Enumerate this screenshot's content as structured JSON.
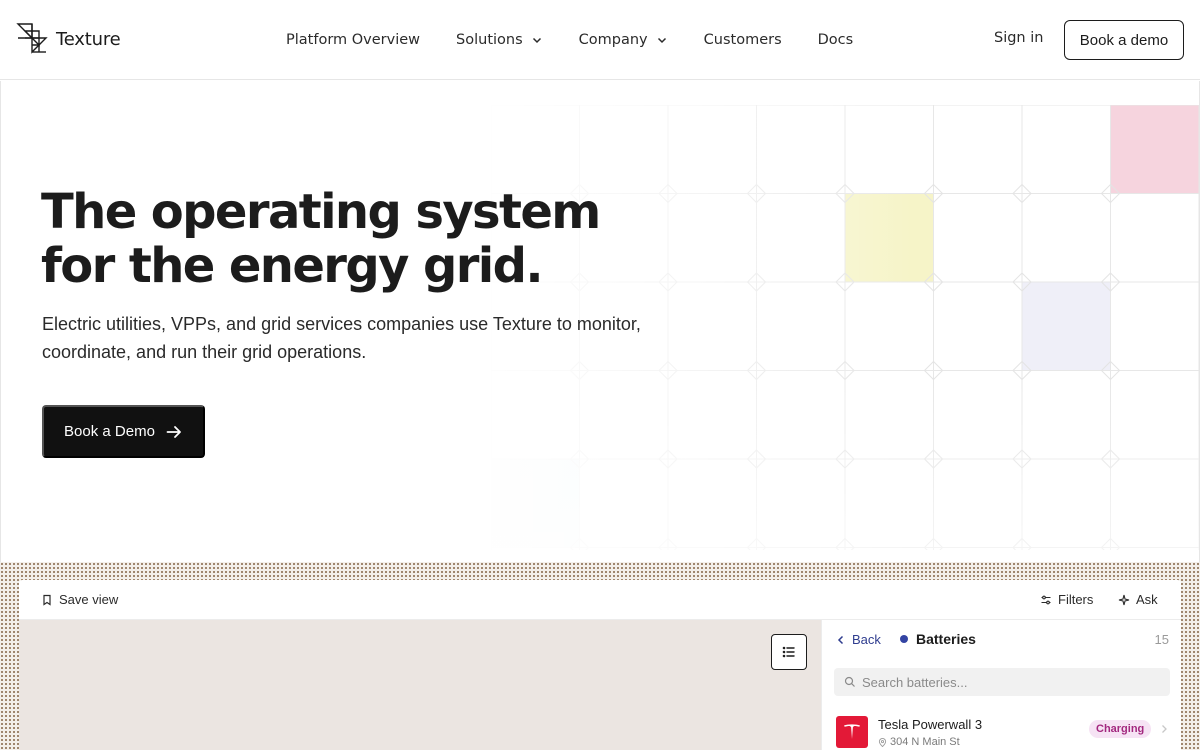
{
  "header": {
    "logo_text": "Texture",
    "nav": [
      {
        "label": "Platform Overview",
        "has_dropdown": false
      },
      {
        "label": "Solutions",
        "has_dropdown": true
      },
      {
        "label": "Company",
        "has_dropdown": true
      },
      {
        "label": "Customers",
        "has_dropdown": false
      },
      {
        "label": "Docs",
        "has_dropdown": false
      }
    ],
    "sign_in": "Sign in",
    "book_demo": "Book a demo"
  },
  "hero": {
    "title_line1": "The operating system",
    "title_line2": "for the energy grid.",
    "subtitle": "Electric utilities, VPPs, and grid services companies use Texture to monitor, coordinate, and run their grid operations.",
    "cta": "Book a Demo",
    "grid_highlights": [
      {
        "col": 7,
        "row": 0,
        "color": "#f6d4de"
      },
      {
        "col": 4,
        "row": 1,
        "color": "#f6f4c8"
      },
      {
        "col": 6,
        "row": 2,
        "color": "#efeff8"
      },
      {
        "col": 0,
        "row": 4,
        "color": "#eef5f6"
      }
    ]
  },
  "app": {
    "toolbar": {
      "save_view": "Save view",
      "filters": "Filters",
      "ask": "Ask"
    },
    "panel": {
      "back": "Back",
      "title": "Batteries",
      "count": "15",
      "search_placeholder": "Search batteries...",
      "items": [
        {
          "name": "Tesla Powerwall 3",
          "address": "304 N Main St",
          "status": "Charging"
        }
      ]
    }
  },
  "colors": {
    "accent_dark": "#111111",
    "link_blue": "#2f3d8f",
    "status_charging_bg": "#f6e3f4",
    "status_charging_fg": "#a3287f",
    "tesla_red": "#e31937"
  }
}
